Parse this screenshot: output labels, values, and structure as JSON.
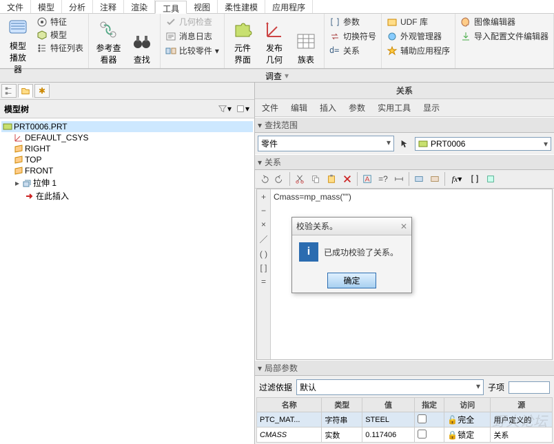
{
  "ribbon_tabs": [
    "文件",
    "模型",
    "分析",
    "注释",
    "渲染",
    "工具",
    "视图",
    "柔性建模",
    "应用程序"
  ],
  "ribbon_active": 5,
  "ribbon": {
    "model_play": "模型播放器",
    "feature": "特征",
    "model": "模型",
    "feature_list": "特征列表",
    "ref_viewer": "参考查看器",
    "find": "查找",
    "geom_check": "几何检查",
    "msg_log": "消息日志",
    "compare_part": "比较零件",
    "comp_ui": "元件界面",
    "publish_geom": "发布几何",
    "family": "族表",
    "params": "参数",
    "switch_sym": "切换符号",
    "relations": "关系",
    "d_eq": "d=",
    "udf_lib": "UDF 库",
    "appearance_mgr": "外观管理器",
    "aux_apps": "辅助应用程序",
    "img_editor": "图像编辑器",
    "import_cfg": "导入配置文件编辑器",
    "investigate": "调查"
  },
  "tree": {
    "title": "模型树",
    "root": "PRT0006.PRT",
    "csys": "DEFAULT_CSYS",
    "right": "RIGHT",
    "top": "TOP",
    "front": "FRONT",
    "extrude": "拉伸 1",
    "insert_here": "在此插入"
  },
  "rel": {
    "title": "关系",
    "menus": [
      "文件",
      "编辑",
      "插入",
      "参数",
      "实用工具",
      "显示"
    ],
    "scope_label": "查找范围",
    "scope_type": "零件",
    "scope_item": "PRT0006",
    "section": "关系",
    "code": "Cmass=mp_mass(\"\")",
    "local_params": "局部参数",
    "filter_label": "过滤依据",
    "filter_value": "默认",
    "sub_label": "子项"
  },
  "dlg": {
    "title": "校验关系。",
    "msg": "已成功校验了关系。",
    "ok": "确定"
  },
  "table": {
    "cols": [
      "名称",
      "类型",
      "值",
      "指定",
      "访问",
      "源"
    ],
    "rows": [
      {
        "name": "PTC_MAT...",
        "type": "字符串",
        "value": "STEEL",
        "access": "完全",
        "src": "用户定义的"
      },
      {
        "name": "CMASS",
        "type": "实数",
        "value": "0.117406",
        "access": "锁定",
        "src": "关系"
      }
    ]
  },
  "watermark": "野火论坛"
}
